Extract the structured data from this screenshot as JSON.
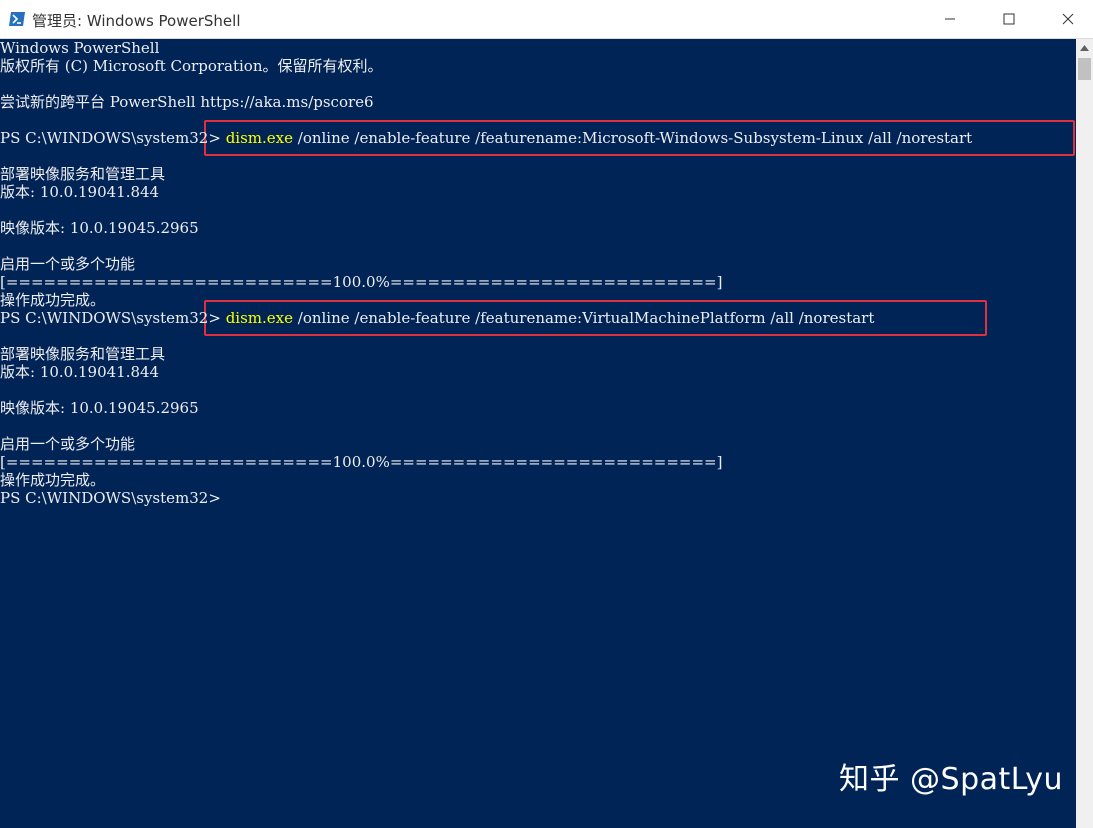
{
  "window": {
    "title": "管理员: Windows PowerShell",
    "minimize_glyph": "—",
    "maximize_glyph": "☐",
    "close_glyph": "✕"
  },
  "terminal": {
    "lines": [
      "Windows PowerShell",
      "版权所有 (C) Microsoft Corporation。保留所有权利。",
      "",
      "尝试新的跨平台 PowerShell https://aka.ms/pscore6",
      "",
      {
        "prompt": "PS C:\\WINDOWS\\system32> ",
        "command": "dism.exe",
        "args": " /online /enable-feature /featurename:Microsoft-Windows-Subsystem-Linux /all /norestart"
      },
      "",
      "部署映像服务和管理工具",
      "版本: 10.0.19041.844",
      "",
      "映像版本: 10.0.19045.2965",
      "",
      "启用一个或多个功能",
      "[==========================100.0%==========================]",
      "操作成功完成。",
      {
        "prompt": "PS C:\\WINDOWS\\system32> ",
        "command": "dism.exe",
        "args": " /online /enable-feature /featurename:VirtualMachinePlatform /all /norestart"
      },
      "",
      "部署映像服务和管理工具",
      "版本: 10.0.19041.844",
      "",
      "映像版本: 10.0.19045.2965",
      "",
      "启用一个或多个功能",
      "[==========================100.0%==========================]",
      "操作成功完成。",
      "PS C:\\WINDOWS\\system32>"
    ]
  },
  "watermark": "知乎 @SpatLyu",
  "colors": {
    "terminal_bg": "#012456",
    "text": "#eeedf0",
    "command": "#ffff00",
    "highlight_box": "#e03141"
  }
}
